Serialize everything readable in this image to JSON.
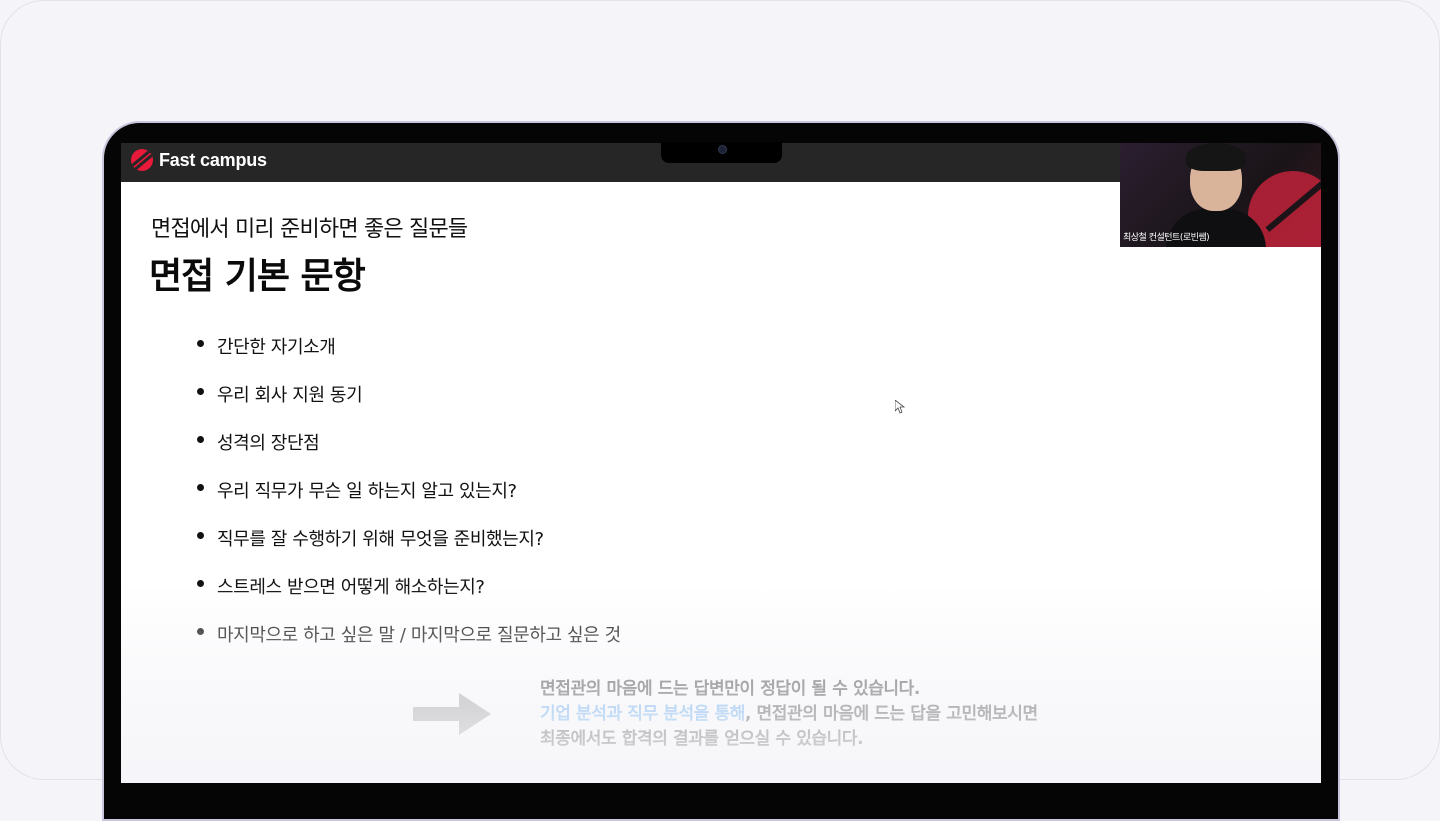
{
  "brand": {
    "name": "Fast campus",
    "color": "#e8193a"
  },
  "slide": {
    "subtitle": "면접에서 미리 준비하면 좋은 질문들",
    "title": "면접 기본 문항",
    "bullets": [
      "간단한 자기소개",
      "우리 회사 지원 동기",
      "성격의 장단점",
      "우리 직무가 무슨 일 하는지 알고 있는지?",
      "직무를 잘 수행하기 위해 무엇을 준비했는지?",
      "스트레스 받으면 어떻게 해소하는지?",
      "마지막으로 하고 싶은 말 / 마지막으로 질문하고 싶은 것"
    ],
    "conclusion": {
      "line1": "면접관의 마음에 드는 답변만이 정답이 될 수 있습니다.",
      "line2_highlight": "기업 분석과 직무 분석을 통해",
      "line2_rest": ", 면접관의 마음에 드는 답을 고민해보시면",
      "line3": "최종에서도 합격의 결과를 얻으실 수 있습니다.",
      "highlight_color": "#5aa5ee"
    }
  },
  "webcam": {
    "label": "최상철 컨설턴트(로빈쌤)"
  }
}
